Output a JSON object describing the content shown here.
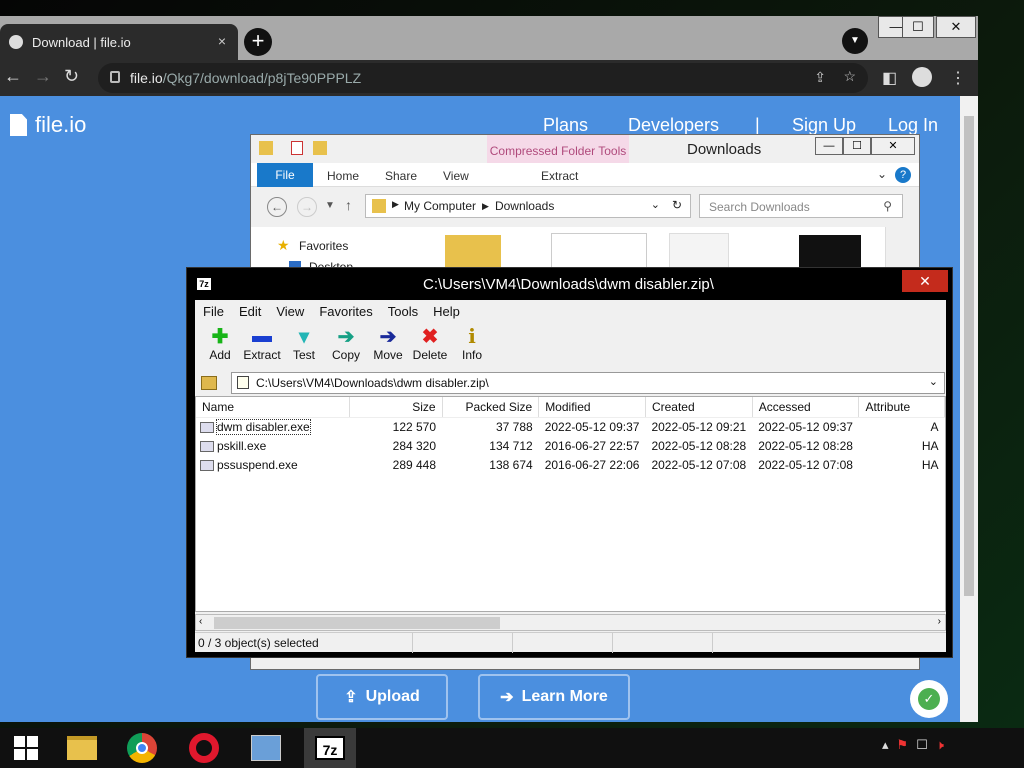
{
  "browser": {
    "tab_title": "Download | file.io",
    "tab_close": "×",
    "new_tab": "+",
    "url_host": "file.io",
    "url_path": "/Qkg7/download/p8jTe90PPPLZ",
    "window_controls": [
      "—",
      "☐",
      "✕"
    ]
  },
  "page": {
    "logo_text": "file.io",
    "nav": [
      "Plans",
      "Developers",
      "|",
      "Sign Up",
      "Log In"
    ],
    "upload_label": "Upload",
    "learn_more_label": "Learn More"
  },
  "explorer": {
    "title": "Downloads",
    "context_tab": "Compressed Folder Tools",
    "ribbon_tabs": [
      "File",
      "Home",
      "Share",
      "View"
    ],
    "context_sub_tab": "Extract",
    "breadcrumb": [
      "My Computer",
      "Downloads"
    ],
    "search_placeholder": "Search Downloads",
    "favorites_label": "Favorites",
    "desktop_label": "Desktop"
  },
  "sevenzip": {
    "title": "C:\\Users\\VM4\\Downloads\\dwm disabler.zip\\",
    "menu": [
      "File",
      "Edit",
      "View",
      "Favorites",
      "Tools",
      "Help"
    ],
    "toolbar": [
      {
        "label": "Add",
        "glyph": "✚",
        "color": "#18b418"
      },
      {
        "label": "Extract",
        "glyph": "▬",
        "color": "#1a3fd1"
      },
      {
        "label": "Test",
        "glyph": "▾",
        "color": "#23b5b5"
      },
      {
        "label": "Copy",
        "glyph": "➔",
        "color": "#16a085"
      },
      {
        "label": "Move",
        "glyph": "➔",
        "color": "#1a2a9a"
      },
      {
        "label": "Delete",
        "glyph": "✖",
        "color": "#e02020"
      },
      {
        "label": "Info",
        "glyph": "i",
        "color": "#b08a00"
      }
    ],
    "path": "C:\\Users\\VM4\\Downloads\\dwm disabler.zip\\",
    "columns": [
      "Name",
      "Size",
      "Packed Size",
      "Modified",
      "Created",
      "Accessed",
      "Attribute"
    ],
    "rows": [
      {
        "name": "dwm disabler.exe",
        "size": "122 570",
        "packed": "37 788",
        "modified": "2022-05-12 09:37",
        "created": "2022-05-12 09:21",
        "accessed": "2022-05-12 09:37",
        "attr": "A"
      },
      {
        "name": "pskill.exe",
        "size": "284 320",
        "packed": "134 712",
        "modified": "2016-06-27 22:57",
        "created": "2022-05-12 08:28",
        "accessed": "2022-05-12 08:28",
        "attr": "HA"
      },
      {
        "name": "pssuspend.exe",
        "size": "289 448",
        "packed": "138 674",
        "modified": "2016-06-27 22:06",
        "created": "2022-05-12 07:08",
        "accessed": "2022-05-12 07:08",
        "attr": "HA"
      }
    ],
    "status": "0 / 3 object(s) selected"
  },
  "taskbar": {
    "apps": [
      "start",
      "file-explorer",
      "chrome",
      "opera",
      "control-panel",
      "7-zip"
    ],
    "sevenzip_label": "7z"
  }
}
